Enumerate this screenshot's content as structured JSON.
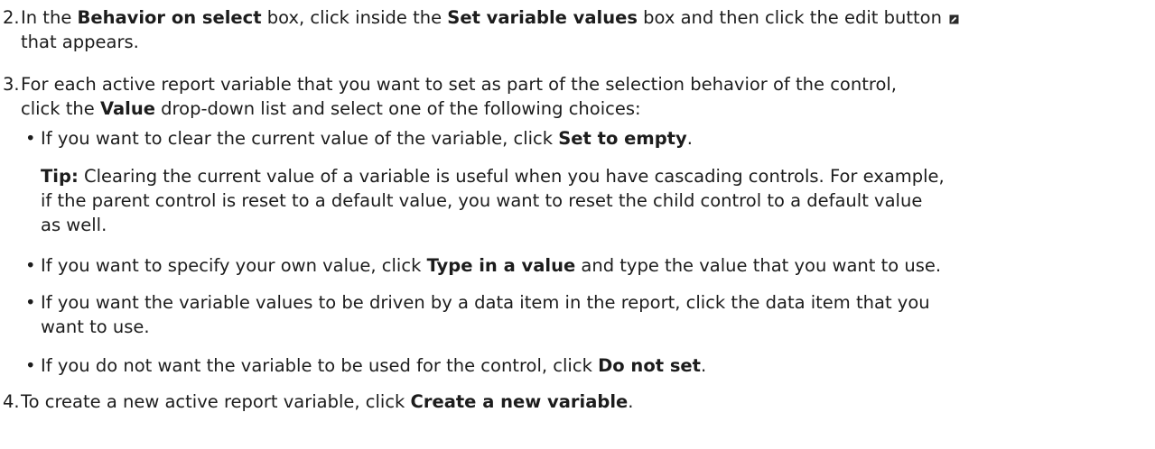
{
  "steps": [
    {
      "number": "2.",
      "line1_pre": "In the ",
      "b1": "Behavior on select",
      "line1_mid1": " box, click inside the ",
      "b2": "Set variable values",
      "line1_mid2": " box and then click the edit button ",
      "line2": "that appears.",
      "icon": "edit-icon"
    },
    {
      "number": "3.",
      "line1": "For each active report variable that you want to set as part of the selection behavior of the control,",
      "line2_pre": "click the ",
      "b1": "Value",
      "line2_post": " drop-down list and select one of the following choices:"
    },
    {
      "number": "4.",
      "pre": "To create a new active report variable, click ",
      "b1": "Create a new variable",
      "post": "."
    }
  ],
  "bullets": [
    {
      "dot": "•",
      "pre": "If you want to clear the current value of the variable, click ",
      "b1": "Set to empty",
      "post": "."
    },
    {
      "dot": "•",
      "pre": "If you want to specify your own value, click ",
      "b1": "Type in a value",
      "post": " and type the value that you want to use."
    },
    {
      "dot": "•",
      "line1": "If you want the variable values to be driven by a data item in the report, click the data item that you",
      "line2": "want to use."
    },
    {
      "dot": "•",
      "pre": "If you do not want the variable to be used for the control, click ",
      "b1": "Do not set",
      "post": "."
    }
  ],
  "tip": {
    "label": "Tip:",
    "line1": " Clearing the current value of a variable is useful when you have cascading controls. For example,",
    "line2": "if the parent control is reset to a default value, you want to reset the child control to a default value",
    "line3": "as well."
  }
}
